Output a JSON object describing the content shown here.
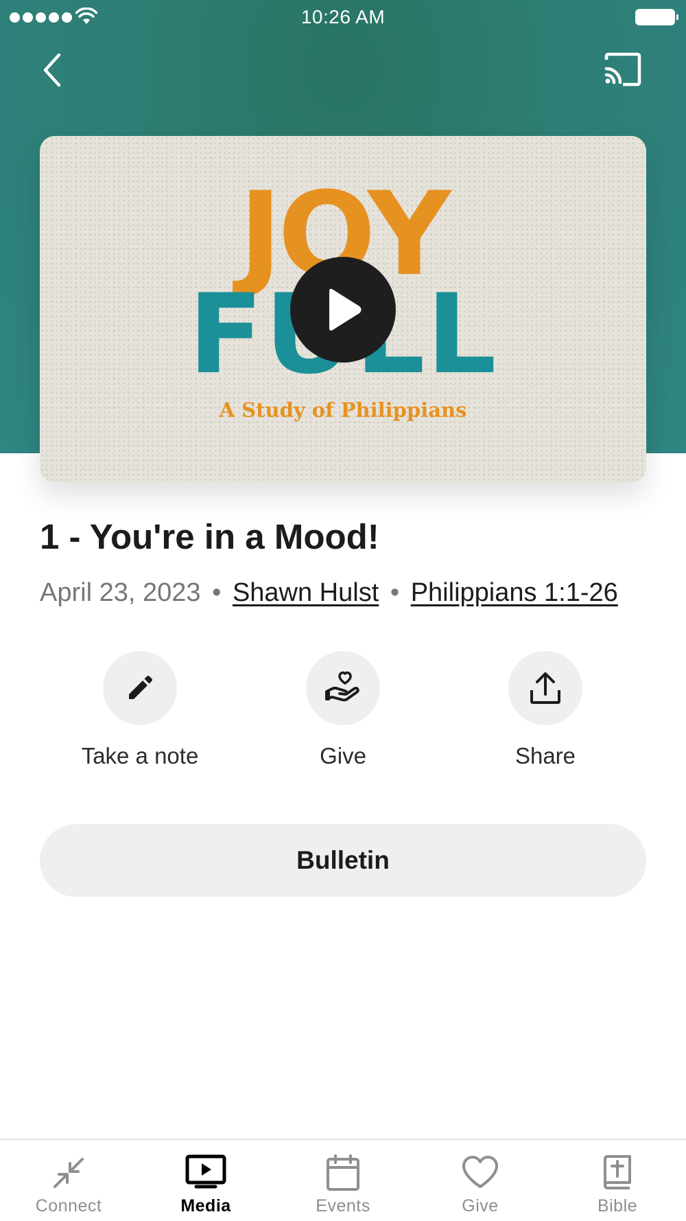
{
  "status_bar": {
    "time": "10:26 AM"
  },
  "video": {
    "art_line1": "JOY",
    "art_line2": "FULL",
    "art_subtitle": "A Study of Philippians",
    "play_icon": "play-icon"
  },
  "sermon": {
    "title": "1 - You're in a Mood!",
    "date": "April 23, 2023",
    "separator": "•",
    "speaker": "Shawn Hulst",
    "scripture": "Philippians 1:1-26"
  },
  "actions": [
    {
      "label": "Take a note",
      "icon": "pencil-icon"
    },
    {
      "label": "Give",
      "icon": "giving-hand-icon"
    },
    {
      "label": "Share",
      "icon": "share-icon"
    }
  ],
  "bulletin_label": "Bulletin",
  "tabs": [
    {
      "label": "Connect",
      "icon": "connect-icon",
      "active": false
    },
    {
      "label": "Media",
      "icon": "media-icon",
      "active": true
    },
    {
      "label": "Events",
      "icon": "calendar-icon",
      "active": false
    },
    {
      "label": "Give",
      "icon": "heart-icon",
      "active": false
    },
    {
      "label": "Bible",
      "icon": "bible-icon",
      "active": false
    }
  ],
  "colors": {
    "header": "#2d7e74",
    "art_orange": "#e69221",
    "art_teal": "#1b9098",
    "button_bg": "#eeeff0"
  }
}
